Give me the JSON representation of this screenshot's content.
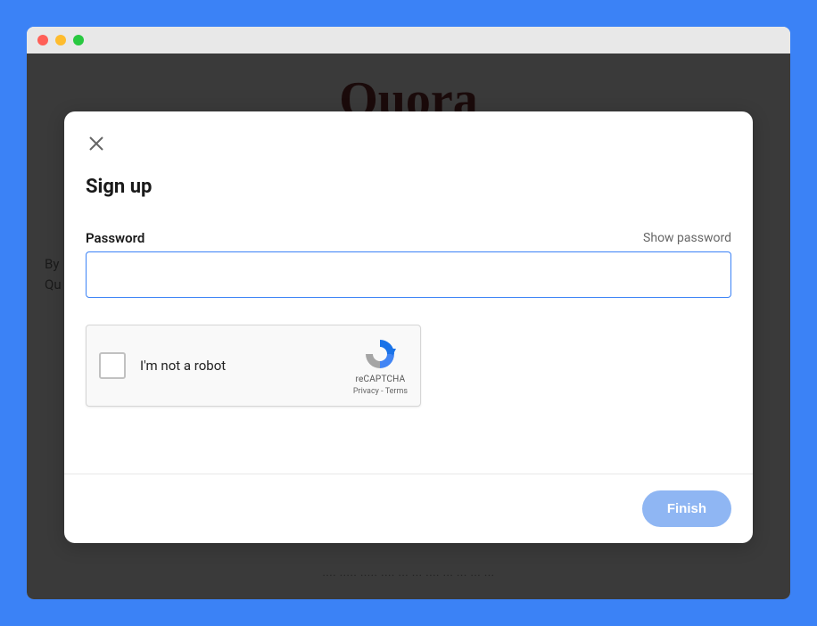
{
  "background": {
    "logo": "Quora",
    "line1": "By",
    "line2": "Qu",
    "footer": "···· ····· ····· ···· ··· ··· ···· ··· ··· ··· ···"
  },
  "modal": {
    "title": "Sign up",
    "password_label": "Password",
    "show_password": "Show password",
    "password_value": "",
    "recaptcha": {
      "label": "I'm not a robot",
      "brand": "reCAPTCHA",
      "privacy": "Privacy",
      "terms": "Terms"
    },
    "finish_label": "Finish"
  }
}
